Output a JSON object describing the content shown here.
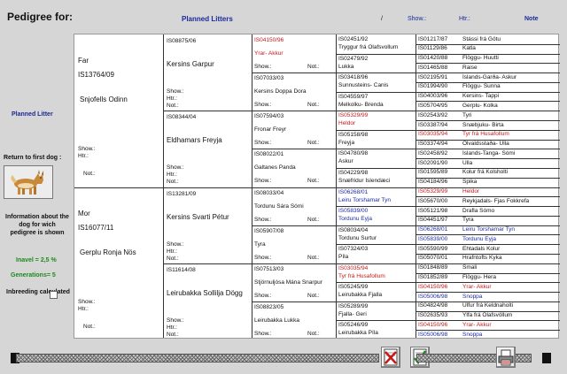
{
  "header": {
    "title": "Pedigree for:",
    "planned": "Planned Litters",
    "slash": "/",
    "show": "Show.:",
    "htr": "Htr.:",
    "note": "Note"
  },
  "sidebar": {
    "planned_litter": "Planned Litter",
    "return_label": "Return to first dog :",
    "info": "Information about the dog for wich pedigree is shown",
    "inavel": "Inavel = 2,5 %",
    "generations": "Generations= 5",
    "inbreeding": "Inbreeding calculated"
  },
  "parents": [
    {
      "role": "Far",
      "reg": "IS13764/09",
      "name": "Snjofells Odinn",
      "show": "Show.:",
      "htr": "Htr.:",
      "not": "Not.:"
    },
    {
      "role": "Mor",
      "reg": "IS16077/11",
      "name": "Gerplu Ronja Nös",
      "show": "Show.:",
      "htr": "Htr.:",
      "not": "Not.:"
    }
  ],
  "grandparents": [
    {
      "reg": "IS08875/06",
      "name": "Kersins Garpur",
      "show": "Show.:",
      "htr": "Htr.:",
      "not": "Not.:"
    },
    {
      "reg": "IS08344/04",
      "name": "Eldhamars Freyja",
      "show": "Show.:",
      "htr": "Htr.:",
      "not": "Not.:"
    },
    {
      "reg": "IS13281/09",
      "name": "Kersins Svarti Pétur",
      "show": "Show.:",
      "htr": "Htr.:",
      "not": "Not.:"
    },
    {
      "reg": "IS11614/08",
      "name": "Leirubakka Sollilja Dögg",
      "show": "Show.:",
      "htr": "Htr.:",
      "not": "Not.:"
    }
  ],
  "great_grandparents": [
    {
      "reg": "IS04150/96",
      "reg_color": "red",
      "name": "Yrar- Akkur",
      "name_color": "red",
      "show": "Show.:",
      "not": "Not.:"
    },
    {
      "reg": "IS07033/03",
      "reg_color": "",
      "name": "Kersins Doppa Dora",
      "name_color": "",
      "show": "Show.:",
      "not": "Not.:"
    },
    {
      "reg": "IS07594/03",
      "reg_color": "",
      "name": "Fronar Freyr",
      "name_color": "",
      "show": "Show.:",
      "not": "Not.:"
    },
    {
      "reg": "IS08022/01",
      "reg_color": "",
      "name": "Galtanes Panda",
      "name_color": "",
      "show": "Show.:",
      "not": "Not.:"
    },
    {
      "reg": "IS08033/04",
      "reg_color": "",
      "name": "Tordunu Sára Sómi",
      "name_color": "",
      "show": "Show.:",
      "not": "Not.:"
    },
    {
      "reg": "IS05907/08",
      "reg_color": "",
      "name": "Tyra",
      "name_color": "",
      "show": "Show.:",
      "not": "Not.:"
    },
    {
      "reg": "IS07513/03",
      "reg_color": "",
      "name": "Stjörnuljósa Mána Snarpur",
      "name_color": "",
      "show": "Show.:",
      "not": "Not.:"
    },
    {
      "reg": "IS08823/05",
      "reg_color": "",
      "name": "Leirubakka Lukka",
      "name_color": "",
      "show": "Show.:",
      "not": "Not.:"
    }
  ],
  "gen4": [
    {
      "reg": "IS02451/92",
      "reg_color": "",
      "name": "Tryggur frá Olafsvollum",
      "name_color": ""
    },
    {
      "reg": "IS02479/92",
      "reg_color": "",
      "name": "Lukka",
      "name_color": ""
    },
    {
      "reg": "IS03418/96",
      "reg_color": "",
      "name": "Sunnusteins- Canis",
      "name_color": ""
    },
    {
      "reg": "IS04559/97",
      "reg_color": "",
      "name": "Melkolku- Brenda",
      "name_color": ""
    },
    {
      "reg": "IS05329/99",
      "reg_color": "red",
      "name": "Heldor",
      "name_color": "red"
    },
    {
      "reg": "IS05158/98",
      "reg_color": "",
      "name": "Freyja",
      "name_color": ""
    },
    {
      "reg": "IS04780/98",
      "reg_color": "",
      "name": "Askur",
      "name_color": ""
    },
    {
      "reg": "IS04229/98",
      "reg_color": "",
      "name": "Snæfridur Íslendæci",
      "name_color": ""
    },
    {
      "reg": "IS06268/01",
      "reg_color": "blue",
      "name": "Leiru Torshamar Tyn",
      "name_color": "blue"
    },
    {
      "reg": "IS05839/00",
      "reg_color": "blue",
      "name": "Tordunu Eyja",
      "name_color": "blue"
    },
    {
      "reg": "IS08034/04",
      "reg_color": "",
      "name": "Tordunu Surtur",
      "name_color": ""
    },
    {
      "reg": "IS07324/03",
      "reg_color": "",
      "name": "Píla",
      "name_color": ""
    },
    {
      "reg": "IS03035/94",
      "reg_color": "red",
      "name": "Tyr frá Husafollum",
      "name_color": "red"
    },
    {
      "reg": "IS05245/99",
      "reg_color": "",
      "name": "Leirubakka Fjalla",
      "name_color": ""
    },
    {
      "reg": "IS05289/99",
      "reg_color": "",
      "name": "Fjalla- Geri",
      "name_color": ""
    },
    {
      "reg": "IS05246/99",
      "reg_color": "",
      "name": "Leirubakka Píla",
      "name_color": ""
    }
  ],
  "gen5": [
    {
      "reg": "IS01217/87",
      "name": "Stássi frá Götu",
      "color": ""
    },
    {
      "reg": "IS01129/86",
      "name": "Katla",
      "color": ""
    },
    {
      "reg": "IS01420/88",
      "name": "Flöggu- Huutti",
      "color": ""
    },
    {
      "reg": "IS01465/88",
      "name": "Raise",
      "color": ""
    },
    {
      "reg": "IS02195/91",
      "name": "Íslands-Garða- Askur",
      "color": ""
    },
    {
      "reg": "IS01994/90",
      "name": "Flöggu- Sunna",
      "color": ""
    },
    {
      "reg": "IS04003/96",
      "name": "Kersins- Tappi",
      "color": ""
    },
    {
      "reg": "IS05704/95",
      "name": "Gerplu- Kolka",
      "color": ""
    },
    {
      "reg": "IS02543/92",
      "name": "Tyri",
      "color": ""
    },
    {
      "reg": "IS03387/94",
      "name": "Snæbjuku- Birta",
      "color": ""
    },
    {
      "reg": "IS03035/94",
      "name": "Tyr frá Husafollum",
      "color": "red"
    },
    {
      "reg": "IS03374/94",
      "name": "Ölvaldsstaða- Ulla",
      "color": ""
    },
    {
      "reg": "IS02458/92",
      "name": "Íslands-Tanga- Sómi",
      "color": ""
    },
    {
      "reg": "IS02091/90",
      "name": "Ulla",
      "color": ""
    },
    {
      "reg": "IS01595/89",
      "name": "Kolur frá Kolsholti",
      "color": ""
    },
    {
      "reg": "IS04184/96",
      "name": "Spika",
      "color": ""
    },
    {
      "reg": "IS05329/99",
      "name": "Heldor",
      "color": "red"
    },
    {
      "reg": "IS05670/00",
      "name": "Reykjadals- Fjas Fokkrefa",
      "color": ""
    },
    {
      "reg": "IS05121/98",
      "name": "Drafla Sómo",
      "color": ""
    },
    {
      "reg": "IS04451/97",
      "name": "Tyra",
      "color": ""
    },
    {
      "reg": "IS06268/01",
      "name": "Leiru Torshamar Tyn",
      "color": "blue"
    },
    {
      "reg": "IS05839/00",
      "name": "Tordunu Eyja",
      "color": "blue"
    },
    {
      "reg": "IS05590/99",
      "name": "Ehtadals Kolur",
      "color": ""
    },
    {
      "reg": "IS05070/01",
      "name": "Hrafntofts Kyka",
      "color": ""
    },
    {
      "reg": "IS01848/89",
      "name": "Smali",
      "color": ""
    },
    {
      "reg": "IS01852/89",
      "name": "Flöggu- Hera",
      "color": ""
    },
    {
      "reg": "IS04150/96",
      "name": "Yrar- Akkur",
      "color": "red"
    },
    {
      "reg": "IS05006/98",
      "name": "Snoppa",
      "color": "blue"
    },
    {
      "reg": "IS04824/98",
      "name": "Ulfur frá Keldnaholti",
      "color": ""
    },
    {
      "reg": "IS02635/93",
      "name": "Ylfa frá Olafsvöllum",
      "color": ""
    },
    {
      "reg": "IS04150/96",
      "name": "Yrar- Akkur",
      "color": "red"
    },
    {
      "reg": "IS05006/98",
      "name": "Snoppa",
      "color": "blue"
    }
  ]
}
